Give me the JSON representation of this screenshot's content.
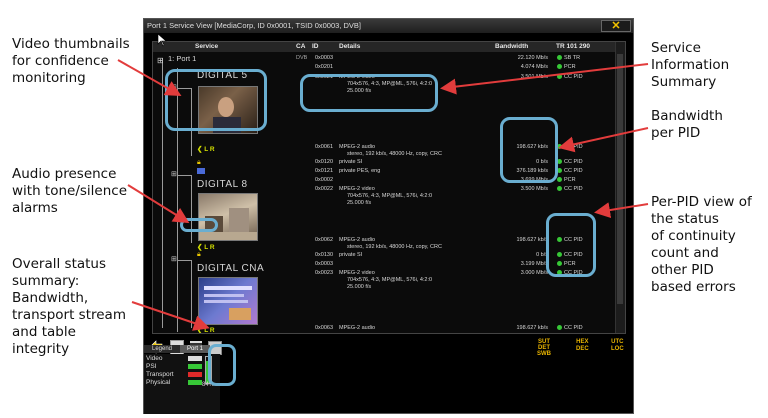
{
  "window": {
    "title": "Port 1 Service View  [MediaCorp, ID 0x0001, TSID 0x0003, DVB]",
    "close_label": "✕"
  },
  "columns": {
    "service": "Service",
    "ca": "CA",
    "id": "ID",
    "details": "Details",
    "bandwidth": "Bandwidth",
    "tr": "TR 101 290"
  },
  "port_row": {
    "label": "1: Port 1",
    "pid": "0x0003",
    "bandwidth": "22.120 Mb/s",
    "status": "SB  TR"
  },
  "rows": {
    "r0_pid": "0x0201",
    "r0_bw": "4.074 Mb/s",
    "r0_st": "PCR",
    "svc1_name": "DIGITAL 5",
    "r1_pid": "0x0021",
    "r1_d1": "MPEG-2 video",
    "r1_d2": "704x576, 4:3, MP@ML, 576i, 4:2:0",
    "r1_d3": "25.000 f/s",
    "r1_bw": "3.501 Mb/s",
    "r1_st": "CC    PID",
    "r2_pid": "0x0061",
    "r2_d1": "MPEG-2 audio",
    "r2_d2": "stereo, 192 kb/s, 48000 Hz, copy, CRC",
    "r2_bw": "198.627 kb/s",
    "r2_st": "CC    PID",
    "r3_pid": "0x0120",
    "r3_d1": "private SI",
    "r3_bw": "0 b/s",
    "r3_st": "CC    PID",
    "r4_pid": "0x0121",
    "r4_d1": "private PES, eng",
    "r4_bw": "376.189 kb/s",
    "r4_st": "CC    PID",
    "r5_pid": "0x0002",
    "r5_bw": "3.699 Mb/s",
    "r5_st": "PCR",
    "svc2_name": "DIGITAL 8",
    "r6_pid": "0x0022",
    "r6_d1": "MPEG-2 video",
    "r6_d2": "704x576, 4:3, MP@ML, 576i, 4:2:0",
    "r6_d3": "25.000 f/s",
    "r6_bw": "3.500 Mb/s",
    "r6_st": "CC    PID",
    "r7_pid": "0x0062",
    "r7_d1": "MPEG-2 audio",
    "r7_d2": "stereo, 192 kb/s, 48000 Hz, copy, CRC",
    "r7_bw": "198.627 kb/s",
    "r7_st": "CC    PID",
    "r8_pid": "0x0130",
    "r8_d1": "private SI",
    "r8_bw": "0 b/s",
    "r8_st": "CC    PID",
    "r9_pid": "0x0003",
    "r9_bw": "3.199 Mb/s",
    "r9_st": "PCR",
    "svc3_name": "DIGITAL CNA",
    "r10_pid": "0x0023",
    "r10_d1": "MPEG-2 video",
    "r10_d2": "704x576, 4:3, MP@ML, 576i, 4:2:0",
    "r10_d3": "25.000 f/s",
    "r10_bw": "3.000 Mb/s",
    "r10_st": "CC    PID",
    "r11_pid": "0x0063",
    "r11_d1": "MPEG-2 audio",
    "r11_bw": "198.627 kb/s",
    "r11_st": "CC    PID"
  },
  "audio_indicator": "L R",
  "toolbar": {
    "sut": "SUT\nDET\nSWB",
    "hex": "HEX\nDEC",
    "utc": "UTC\nLOC"
  },
  "legend": {
    "tab_legend": "Legend",
    "tab_port": "Port 1",
    "video": "Video",
    "psi": "PSI",
    "transport": "Transport",
    "physical": "Physical",
    "percent": "84%"
  },
  "callouts": {
    "thumb": [
      "Video thumbnails",
      "for confidence",
      "monitoring"
    ],
    "audio": [
      "Audio presence",
      "with tone/silence",
      "alarms"
    ],
    "overall": [
      "Overall status",
      "summary:",
      "Bandwidth,",
      "transport stream",
      "and table",
      "integrity"
    ],
    "service": [
      "Service",
      "Information",
      "Summary"
    ],
    "bandwidth": [
      "Bandwidth",
      "per PID"
    ],
    "perpid": [
      "Per-PID view of",
      "the status",
      "of continuity",
      "count and",
      "other PID",
      "based errors"
    ]
  },
  "colors": {
    "ring": "#6aaed0",
    "arrow": "#e23c3c",
    "ok": "#37c837",
    "err": "#e02a2a",
    "accent": "#f2c200"
  }
}
